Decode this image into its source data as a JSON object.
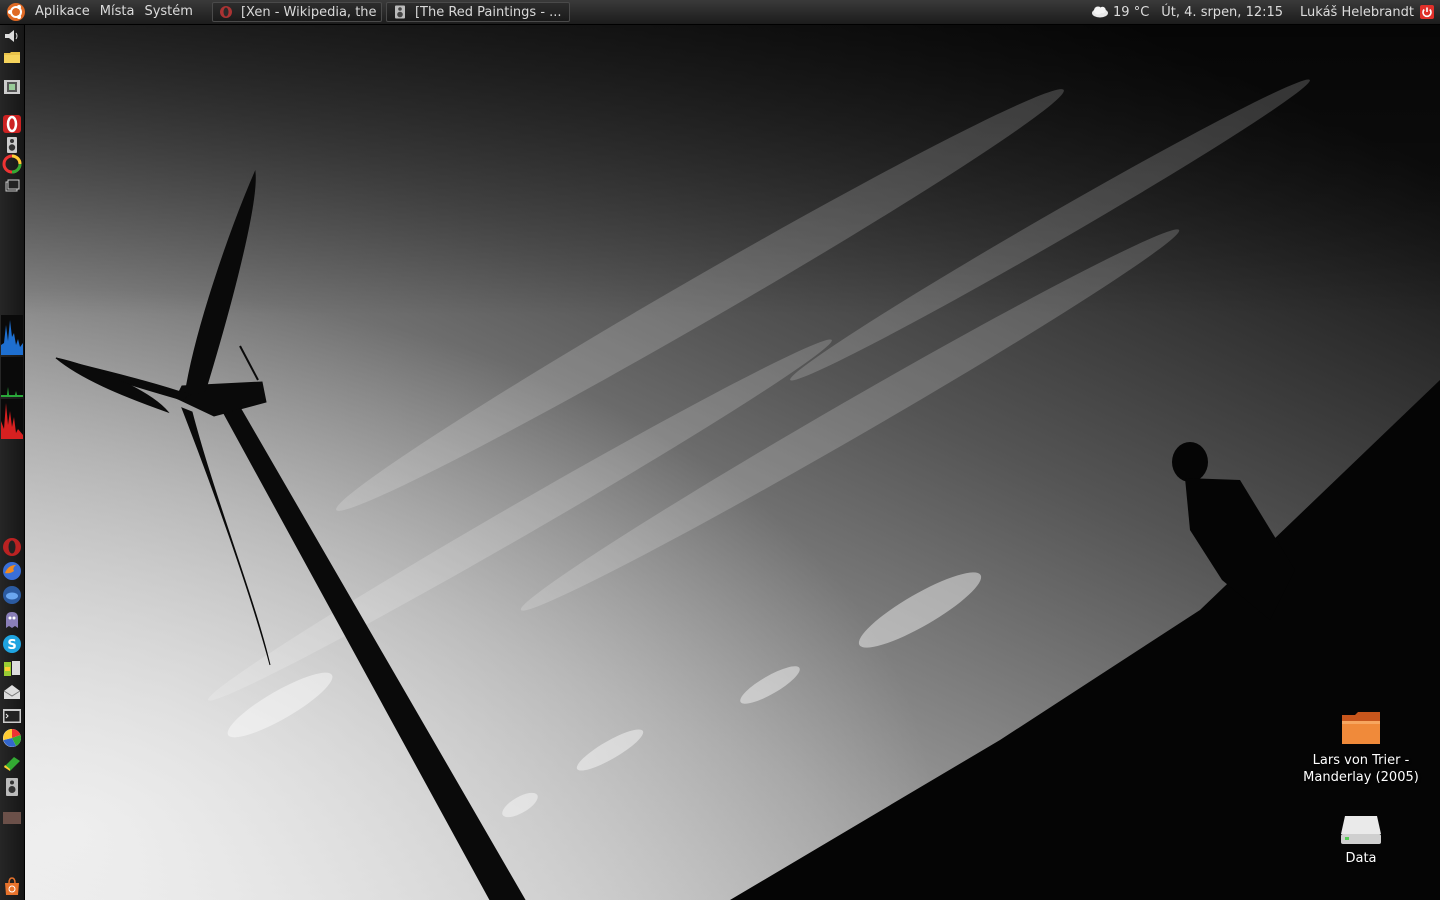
{
  "top_panel": {
    "menus": [
      "Aplikace",
      "Místa",
      "Systém"
    ],
    "tasks": [
      {
        "title": "[Xen - Wikipedia, the ...",
        "icon": "opera-icon"
      },
      {
        "title": "[The Red Paintings - ...",
        "icon": "speaker-icon"
      }
    ],
    "weather": {
      "temperature": "19 °C",
      "icon": "cloud-icon"
    },
    "clock": "Út,  4. srpen, 12:15",
    "user": "Lukáš Helebrandt",
    "power_icon": "power-icon"
  },
  "left_panel": {
    "top_launchers": [
      "volume-icon",
      "folder-icon",
      "film-icon",
      "opera-icon",
      "speaker-icon",
      "color-wheel-icon",
      "windows-icon"
    ],
    "monitors": [
      "cpu-graph",
      "network-graph",
      "memory-graph"
    ],
    "bottom_launchers": [
      "opera-icon",
      "firefox-icon",
      "thunderbird-icon",
      "pidgin-icon",
      "skype-icon",
      "office-icon",
      "mail-icon",
      "terminal-icon",
      "picasa-icon",
      "book-icon",
      "speaker-icon",
      "trash-icon",
      "ubuntu-store-icon"
    ]
  },
  "desktop": {
    "icons": [
      {
        "label": "Lars von Trier - Manderlay (2005)",
        "icon": "folder-icon"
      },
      {
        "label": "Data",
        "icon": "drive-icon"
      }
    ]
  },
  "colors": {
    "panel": "#1f1f1f",
    "accent_orange": "#f07c2c",
    "power_red": "#e0302a"
  }
}
